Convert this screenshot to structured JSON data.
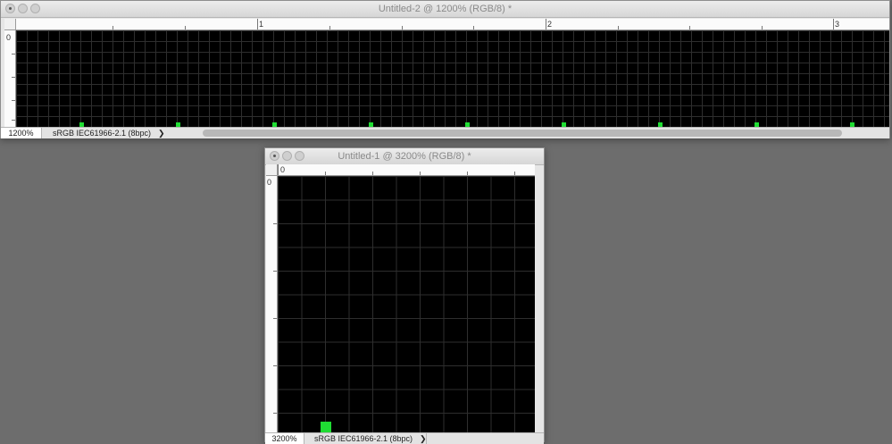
{
  "windows": {
    "top": {
      "title": "Untitled-2 @ 1200% (RGB/8) *",
      "ruler_h_labels": [
        "1",
        "2",
        "3"
      ],
      "ruler_v_label": "0",
      "zoom": "1200%",
      "doc_info": "sRGB IEC61966-2.1 (8bpc)",
      "chevron": "❯"
    },
    "bottom": {
      "title": "Untitled-1 @ 3200% (RGB/8) *",
      "ruler_h_label": "0",
      "ruler_v_label": "0",
      "zoom": "3200%",
      "doc_info": "sRGB IEC61966-2.1 (8bpc)",
      "chevron": "❯"
    }
  },
  "colors": {
    "workspace": "#6d6d6d",
    "canvas": "#000000",
    "pixel": "#1fdc33"
  },
  "icons": {
    "close": "close-icon",
    "minimize": "minimize-icon",
    "zoom": "zoom-icon",
    "chevron": "chevron-right-icon"
  }
}
